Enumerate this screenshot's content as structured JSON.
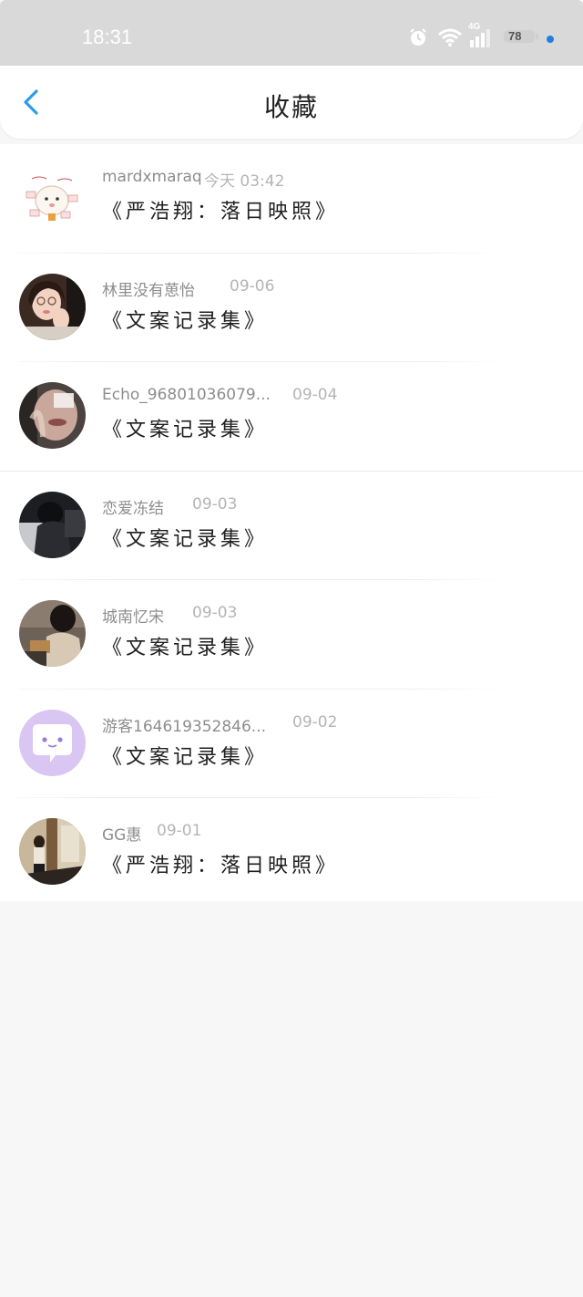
{
  "status_bar": {
    "time": "18:31",
    "network": "4G",
    "battery": "78",
    "icons": [
      "alarm-icon",
      "wifi-icon",
      "signal-icon",
      "battery-icon",
      "notification-dot-icon"
    ]
  },
  "header": {
    "title": "收藏",
    "back_icon": "chevron-left-icon",
    "accent_color": "#2f9be8"
  },
  "items": [
    {
      "username": "mardxmaraq",
      "time": "今天 03:42",
      "title": "《严浩翔：落日映照》",
      "avatar": "cartoon-sticker-avatar"
    },
    {
      "username": "林里没有葸怡",
      "time": "09-06",
      "title": "《文案记录集》",
      "avatar": "girl-portrait-avatar"
    },
    {
      "username": "Echo_96801036079...",
      "time": "09-04",
      "title": "《文案记录集》",
      "avatar": "blurred-selfie-avatar"
    },
    {
      "username": "恋爱冻结",
      "time": "09-03",
      "title": "《文案记录集》",
      "avatar": "dark-photo-avatar"
    },
    {
      "username": "城南忆宋",
      "time": "09-03",
      "title": "《文案记录集》",
      "avatar": "reading-person-avatar"
    },
    {
      "username": "游客164619352846...",
      "time": "09-02",
      "title": "《文案记录集》",
      "avatar": "chat-bubble-default-avatar"
    },
    {
      "username": "GG惠",
      "time": "09-01",
      "title": "《严浩翔：落日映照》",
      "avatar": "person-by-door-avatar"
    }
  ]
}
